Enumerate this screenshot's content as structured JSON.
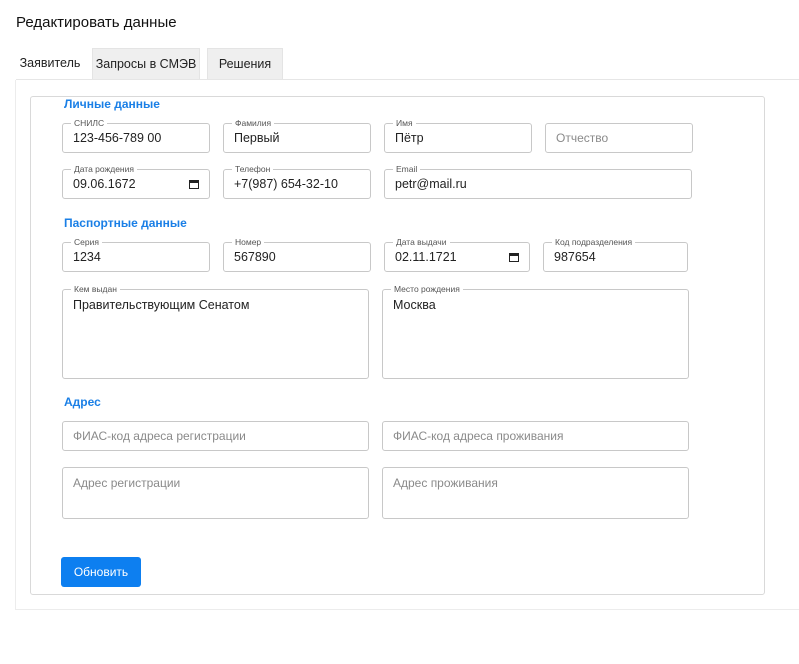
{
  "page": {
    "title": "Редактировать данные"
  },
  "tabs": [
    {
      "label": "Заявитель",
      "active": true
    },
    {
      "label": "Запросы в СМЭВ",
      "active": false
    },
    {
      "label": "Решения",
      "active": false
    }
  ],
  "personal": {
    "section_title": "Личные данные",
    "snils": {
      "label": "СНИЛС",
      "value": "123-456-789 00"
    },
    "last_name": {
      "label": "Фамилия",
      "value": "Первый"
    },
    "first_name": {
      "label": "Имя",
      "value": "Пётр"
    },
    "middle_name": {
      "placeholder": "Отчество"
    },
    "birth_date": {
      "label": "Дата рождения",
      "value": "09.06.1672"
    },
    "phone": {
      "label": "Телефон",
      "value": "+7(987) 654-32-10"
    },
    "email": {
      "label": "Email",
      "value": "petr@mail.ru"
    }
  },
  "passport": {
    "section_title": "Паспортные данные",
    "series": {
      "label": "Серия",
      "value": "1234"
    },
    "number": {
      "label": "Номер",
      "value": "567890"
    },
    "issue_date": {
      "label": "Дата выдачи",
      "value": "02.11.1721"
    },
    "division_code": {
      "label": "Код подразделения",
      "value": "987654"
    },
    "issued_by": {
      "label": "Кем выдан",
      "value": "Правительствующим Сенатом"
    },
    "birth_place": {
      "label": "Место рождения",
      "value": "Москва"
    }
  },
  "address": {
    "section_title": "Адрес",
    "fias_registration": {
      "placeholder": "ФИАС-код адреса регистрации"
    },
    "fias_residence": {
      "placeholder": "ФИАС-код адреса проживания"
    },
    "registration_address": {
      "placeholder": "Адрес регистрации"
    },
    "residence_address": {
      "placeholder": "Адрес проживания"
    }
  },
  "actions": {
    "update_label": "Обновить"
  },
  "colors": {
    "accent": "#1a7fe6",
    "button": "#0d7ff0"
  }
}
